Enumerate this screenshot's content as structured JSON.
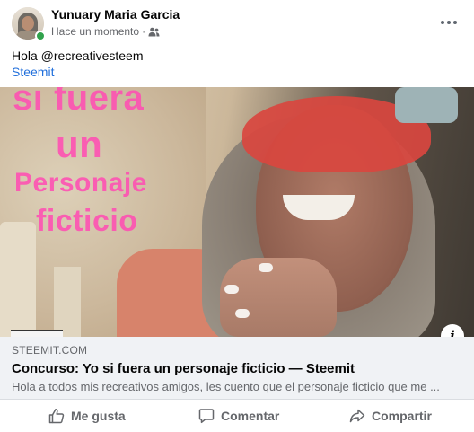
{
  "post": {
    "author": "Yunuary Maria Garcia",
    "timestamp": "Hace un momento",
    "separator": "·",
    "audience_icon": "friends-icon",
    "more_icon": "more-options-icon",
    "text": "Hola @recreativesteem",
    "link_text": "Steemit",
    "online_status_color": "#31a24c"
  },
  "image": {
    "overlay_lines": [
      "si fuera",
      "un",
      "Personaje",
      "ficticio"
    ],
    "overlay_color": "#ff4fb3",
    "info_label": "i"
  },
  "link_preview": {
    "domain": "STEEMIT.COM",
    "title": "Concurso: Yo si fuera un personaje ficticio — Steemit",
    "description": "Hola a todos mis recreativos amigos, les cuento que el personaje ficticio que me ..."
  },
  "actions": {
    "like_label": "Me gusta",
    "comment_label": "Comentar",
    "share_label": "Compartir"
  },
  "colors": {
    "link": "#216fdb",
    "secondary_text": "#65676b",
    "preview_bg": "#f0f2f5"
  }
}
